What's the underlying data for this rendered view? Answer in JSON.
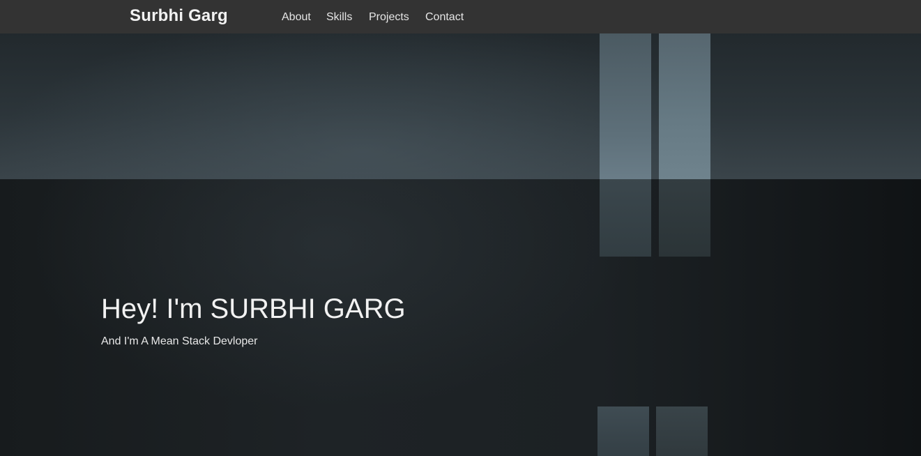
{
  "navbar": {
    "brand": "Surbhi Garg",
    "links": [
      {
        "label": "About"
      },
      {
        "label": "Skills"
      },
      {
        "label": "Projects"
      },
      {
        "label": "Contact"
      }
    ]
  },
  "hero": {
    "title": "Hey! I'm SURBHI GARG",
    "subtitle": "And I'm A Mean Stack Devloper"
  },
  "colors": {
    "navbar_background": "#333333",
    "text": "#f2f2f2",
    "hero_dark": "#15191b",
    "hero_light": "#3a444a"
  }
}
